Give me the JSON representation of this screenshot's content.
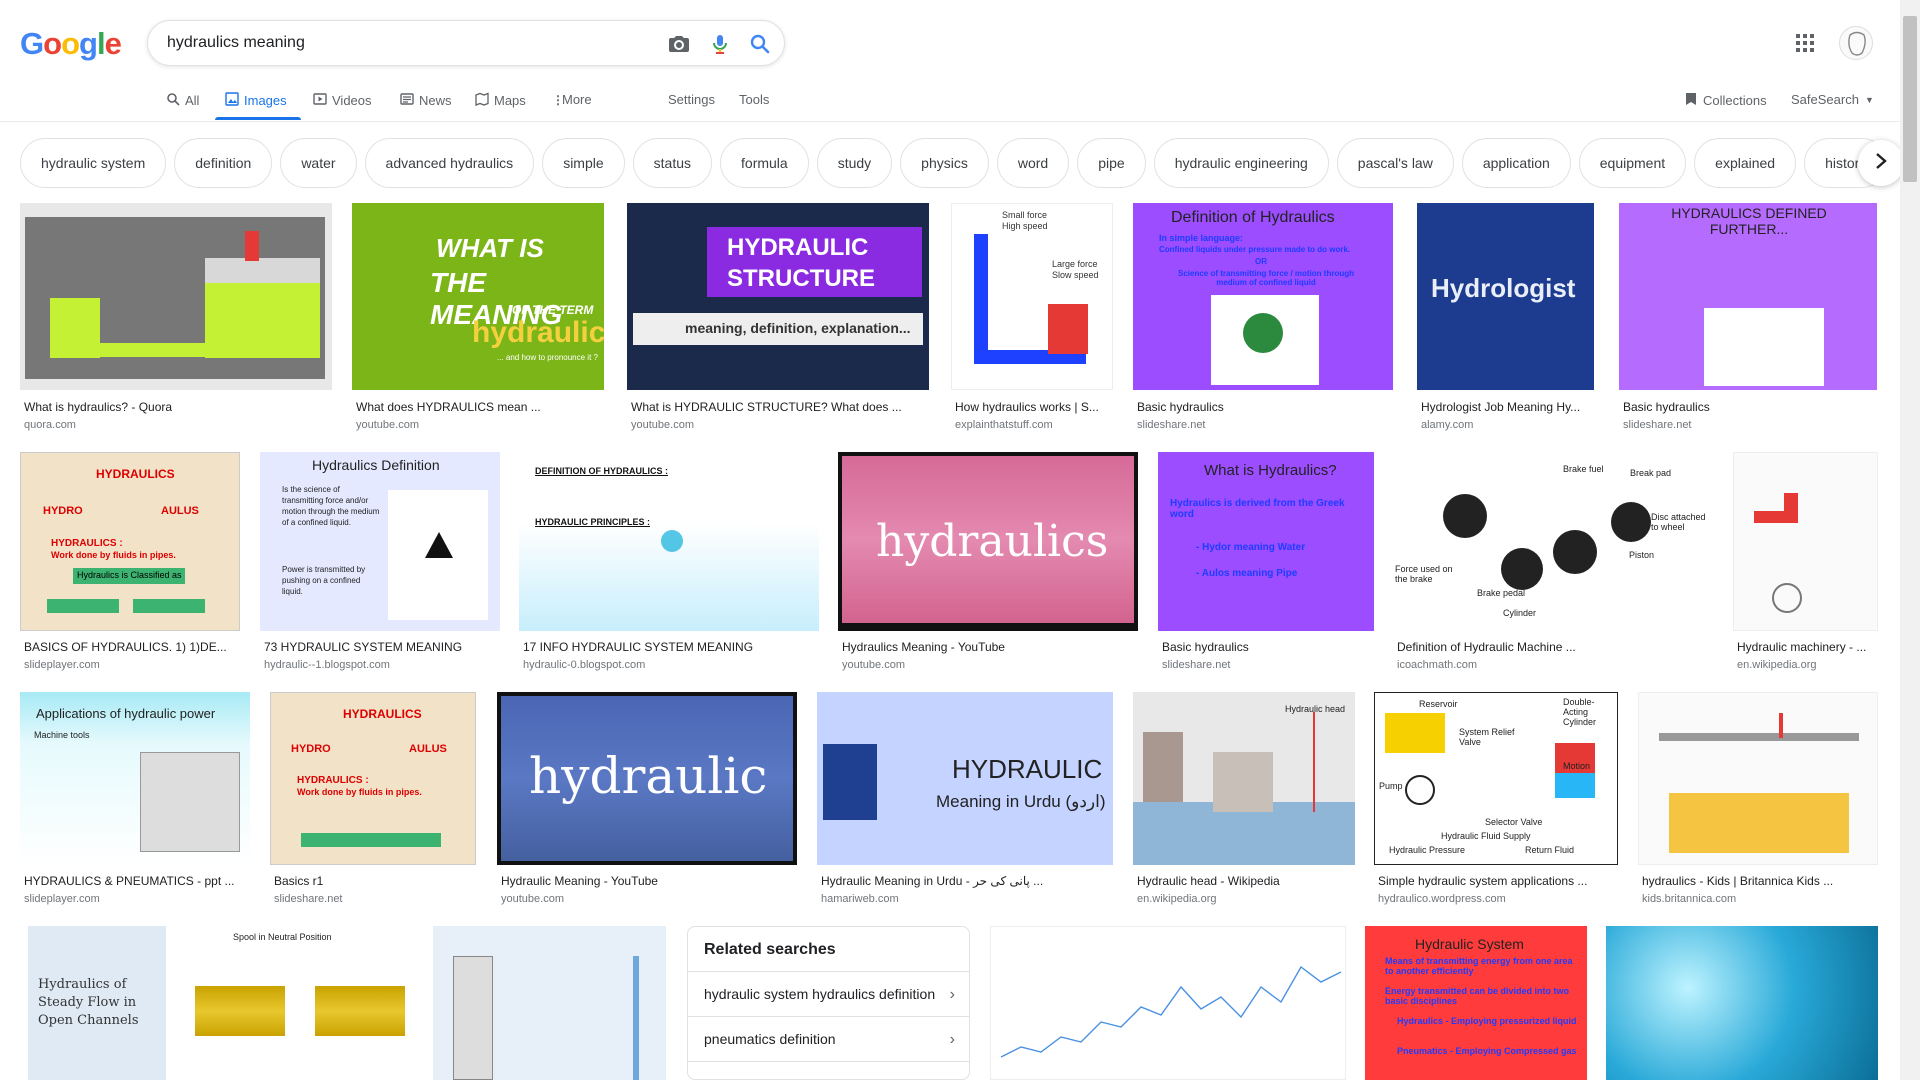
{
  "logo": {
    "text": "Google",
    "colors": [
      "#4285F4",
      "#EA4335",
      "#FBBC05",
      "#4285F4",
      "#34A853",
      "#EA4335"
    ]
  },
  "search": {
    "query": "hydraulics meaning",
    "icons": [
      "camera-icon",
      "mic-icon",
      "search-icon"
    ]
  },
  "tabs": [
    {
      "label": "All",
      "icon": "search-icon"
    },
    {
      "label": "Images",
      "icon": "image-icon",
      "active": true
    },
    {
      "label": "Videos",
      "icon": "video-icon"
    },
    {
      "label": "News",
      "icon": "news-icon"
    },
    {
      "label": "Maps",
      "icon": "map-icon"
    },
    {
      "label": "More",
      "icon": "more-vert-icon"
    }
  ],
  "tools": {
    "settings": "Settings",
    "tools": "Tools"
  },
  "right_tools": {
    "collections": "Collections",
    "safesearch": "SafeSearch"
  },
  "chips": [
    "hydraulic system",
    "definition",
    "water",
    "advanced hydraulics",
    "simple",
    "status",
    "formula",
    "study",
    "physics",
    "word",
    "pipe",
    "hydraulic engineering",
    "pascal's law",
    "application",
    "equipment",
    "explained",
    "history"
  ],
  "row1": [
    {
      "caption": "What is hydraulics? - Quora",
      "source": "quora.com"
    },
    {
      "caption": "What does HYDRAULICS mean ...",
      "source": "youtube.com",
      "overlay": [
        "WHAT IS",
        "THE MEANING",
        "OF THE TERM",
        "hydraulics",
        "... and how to pronounce it ?"
      ]
    },
    {
      "caption": "What is HYDRAULIC STRUCTURE? What does ...",
      "source": "youtube.com",
      "overlay": [
        "HYDRAULIC",
        "STRUCTURE",
        "meaning, definition, explanation..."
      ]
    },
    {
      "caption": "How hydraulics works | S...",
      "source": "explainthatstuff.com",
      "overlay": [
        "Small force",
        "High speed",
        "Large force",
        "Slow speed"
      ]
    },
    {
      "caption": "Basic hydraulics",
      "source": "slideshare.net",
      "overlay": [
        "Definition of Hydraulics",
        "In simple language:",
        "Confined liquids under pressure made to do work.",
        "OR",
        "Science of transmitting force / motion through medium of confined liquid"
      ]
    },
    {
      "caption": "Hydrologist Job Meaning Hy...",
      "source": "alamy.com",
      "overlay": [
        "Hydrologist"
      ]
    },
    {
      "caption": "Basic hydraulics",
      "source": "slideshare.net",
      "overlay": [
        "HYDRAULICS DEFINED FURTHER..."
      ]
    }
  ],
  "row2": [
    {
      "caption": "BASICS OF HYDRAULICS. 1) 1)DE...",
      "source": "slideplayer.com",
      "overlay": [
        "HYDRAULICS",
        "HYDRO",
        "AULUS",
        "HYDRAULICS :",
        "Work done by fluids in pipes.",
        "Hydraulics is Classified as"
      ]
    },
    {
      "caption": "73 HYDRAULIC SYSTEM MEANING",
      "source": "hydraulic--1.blogspot.com",
      "overlay": [
        "Hydraulics Definition",
        "Is the science of transmitting force and/or motion through the medium of a confined liquid.",
        "Power is transmitted by pushing on a confined liquid."
      ]
    },
    {
      "caption": "17 INFO HYDRAULIC SYSTEM MEANING",
      "source": "hydraulic-0.blogspot.com",
      "overlay": [
        "DEFINITION OF HYDRAULICS :",
        "HYDRAULIC PRINCIPLES :"
      ]
    },
    {
      "caption": "Hydraulics Meaning - YouTube",
      "source": "youtube.com",
      "overlay": [
        "hydraulics"
      ]
    },
    {
      "caption": "Basic hydraulics",
      "source": "slideshare.net",
      "overlay": [
        "What is Hydraulics?",
        "Hydraulics is derived from the Greek word",
        "- Hydor meaning Water",
        "- Aulos meaning Pipe"
      ]
    },
    {
      "caption": "Definition of Hydraulic Machine ...",
      "source": "icoachmath.com",
      "overlay": [
        "Brake fuel",
        "Break pad",
        "Disc attached to wheel",
        "Piston",
        "Force used on the brake",
        "Brake pedal",
        "Cylinder"
      ]
    },
    {
      "caption": "Hydraulic machinery - ...",
      "source": "en.wikipedia.org"
    }
  ],
  "row3": [
    {
      "caption": "HYDRAULICS & PNEUMATICS - ppt ...",
      "source": "slideplayer.com",
      "overlay": [
        "Applications of hydraulic power",
        "Machine tools"
      ]
    },
    {
      "caption": "Basics r1",
      "source": "slideshare.net",
      "overlay": [
        "HYDRAULICS",
        "HYDRO",
        "AULUS",
        "HYDRAULICS :",
        "Work done by fluids in pipes."
      ]
    },
    {
      "caption": "Hydraulic Meaning - YouTube",
      "source": "youtube.com",
      "overlay": [
        "hydraulic"
      ]
    },
    {
      "caption": "Hydraulic Meaning in Urdu - پانی کی حر ...",
      "source": "hamariweb.com",
      "overlay": [
        "HYDRAULIC",
        "Meaning in Urdu (اردو)"
      ]
    },
    {
      "caption": "Hydraulic head - Wikipedia",
      "source": "en.wikipedia.org",
      "overlay": [
        "Hydraulic head"
      ]
    },
    {
      "caption": "Simple hydraulic system applications ...",
      "source": "hydraulico.wordpress.com",
      "overlay": [
        "Reservoir",
        "Double-Acting Cylinder",
        "System Relief Valve",
        "Motion",
        "Pump",
        "Selector Valve",
        "Hydraulic Fluid Supply",
        "Hydraulic Pressure",
        "Return Fluid"
      ]
    },
    {
      "caption": "hydraulics - Kids | Britannica Kids ...",
      "source": "kids.britannica.com"
    }
  ],
  "row4": [
    {
      "overlay": [
        "Hydraulics of Steady Flow in Open Channels"
      ]
    },
    {
      "overlay": [
        "Spool in Neutral Position"
      ]
    },
    {},
    {},
    {
      "overlay": [
        "Hydraulic System",
        "Means of transmitting energy from one area to another efficiently",
        "Energy transmitted can be divided into two basic disciplines",
        "Hydraulics - Employing pressurized liquid",
        "Pneumatics - Employing Compressed gas"
      ]
    },
    {}
  ],
  "related": {
    "title": "Related searches",
    "items": [
      "hydraulic system hydraulics definition",
      "pneumatics definition"
    ]
  }
}
